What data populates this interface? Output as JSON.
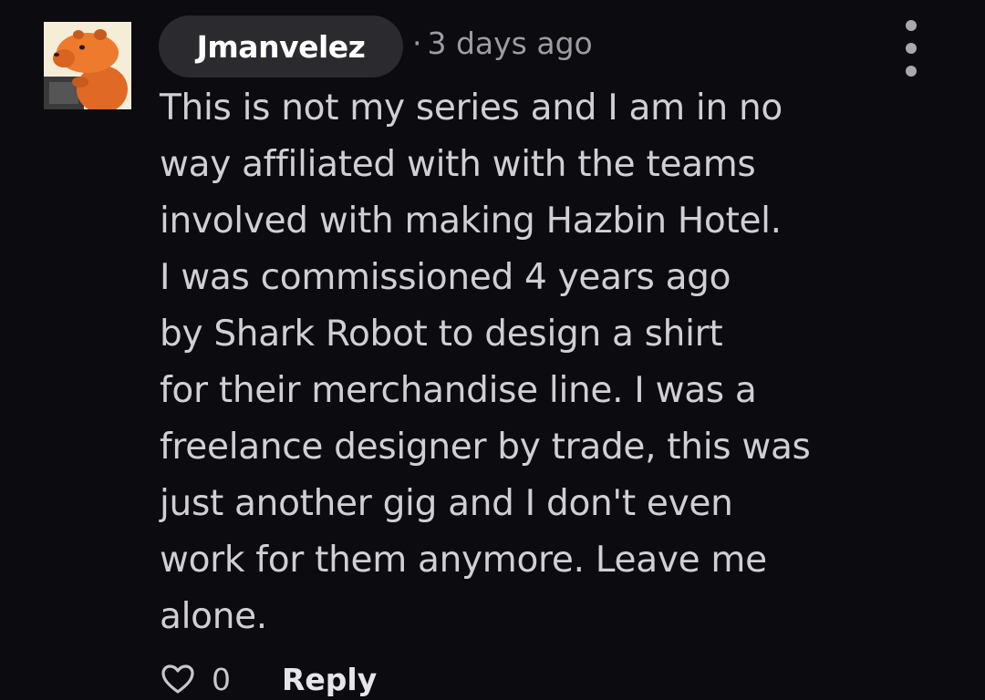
{
  "comment": {
    "author": "Jmanvelez",
    "separator": "·",
    "timestamp": "3 days ago",
    "body_lines": [
      "This is not my series and I am in no",
      "way affiliated with with the teams",
      "involved with making Hazbin Hotel.",
      "I was commissioned 4 years ago",
      "by Shark Robot to design a shirt",
      "for their merchandise line. I was a",
      "freelance designer by trade, this was",
      "just another gig and I don't even",
      "work for them anymore. Leave me",
      "alone."
    ],
    "like_count": "0",
    "reply_label": "Reply",
    "avatar_icon": "capybara-avatar-icon",
    "more_icon": "more-options-icon",
    "like_icon": "heart-outline-icon"
  },
  "colors": {
    "background": "#0b0b10",
    "pill": "#2a2a2f",
    "body_text": "#d0d0d4",
    "meta_text": "#9c9ca4"
  }
}
